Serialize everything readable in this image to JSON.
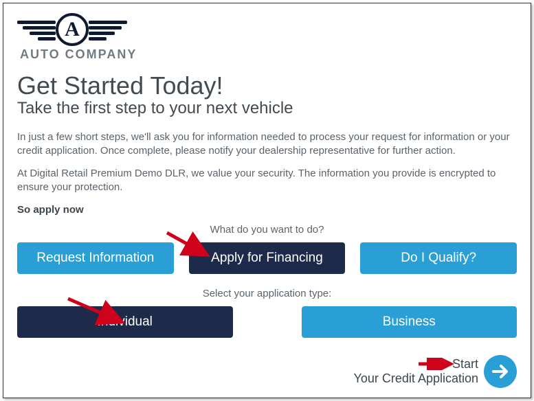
{
  "logo": {
    "letter": "A",
    "company_name": "AUTO COMPANY"
  },
  "heading": "Get Started Today!",
  "subtitle": "Take the first step to your next vehicle",
  "para1": "In just a few short steps, we'll ask you for information needed to process your request for information or your credit application. Once complete, please notify your dealership representative for further action.",
  "para2": "At Digital Retail Premium Demo DLR, we value your security. The information you provide is encrypted to ensure your protection.",
  "so_apply": "So apply now",
  "prompt1": "What do you want to do?",
  "actions": {
    "request_info": "Request Information",
    "apply_financing": "Apply for Financing",
    "do_i_qualify": "Do I Qualify?"
  },
  "prompt2": "Select your application type:",
  "app_types": {
    "individual": "Individual",
    "business": "Business"
  },
  "start": {
    "line1": "Start",
    "line2": "Your Credit Application"
  },
  "colors": {
    "accent": "#2a9fd6",
    "dark": "#1e2a4a",
    "annotation": "#d0021b"
  }
}
